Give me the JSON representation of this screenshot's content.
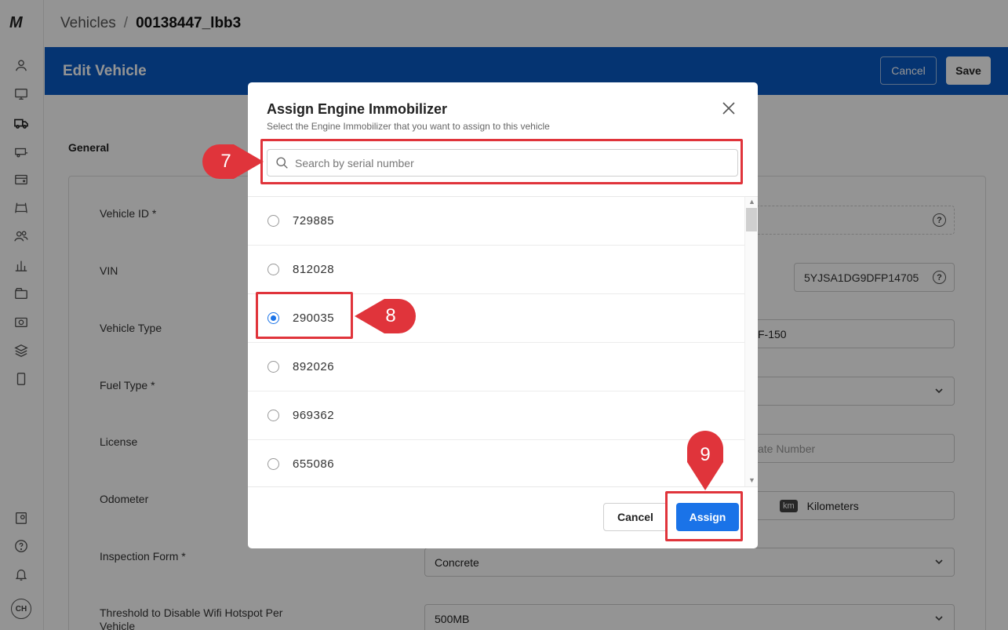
{
  "app": {
    "logo_text": "M",
    "user_initials": "CH"
  },
  "breadcrumb": {
    "root": "Vehicles",
    "separator": "/",
    "current": "00138447_lbb3"
  },
  "header": {
    "title": "Edit Vehicle",
    "cancel_label": "Cancel",
    "save_label": "Save"
  },
  "form": {
    "section_title": "General",
    "fields": [
      {
        "label": "Vehicle ID *"
      },
      {
        "label": "VIN",
        "value": "5YJSA1DG9DFP14705"
      },
      {
        "label": "Vehicle Type",
        "value": "F-150"
      },
      {
        "label": "Fuel Type *"
      },
      {
        "label": "License",
        "placeholder": "ate Number"
      },
      {
        "label": "Odometer",
        "unit_badge": "km",
        "unit": "Kilometers"
      },
      {
        "label": "Inspection Form *",
        "value": "Concrete"
      },
      {
        "label": "Threshold to Disable Wifi Hotspot Per Vehicle",
        "value": "500MB"
      }
    ]
  },
  "modal": {
    "title": "Assign Engine Immobilizer",
    "subtitle": "Select the Engine Immobilizer that you want to assign to this vehicle",
    "search_placeholder": "Search by serial number",
    "items": [
      {
        "serial": "729885",
        "selected": false
      },
      {
        "serial": "812028",
        "selected": false
      },
      {
        "serial": "290035",
        "selected": true
      },
      {
        "serial": "892026",
        "selected": false
      },
      {
        "serial": "969362",
        "selected": false
      },
      {
        "serial": "655086",
        "selected": false
      }
    ],
    "cancel_label": "Cancel",
    "assign_label": "Assign"
  },
  "annotations": {
    "step_search": "7",
    "step_select": "8",
    "step_assign": "9",
    "color": "#e0343b"
  },
  "colors": {
    "header_bg": "#0a5bc4",
    "primary": "#1a73e8"
  }
}
